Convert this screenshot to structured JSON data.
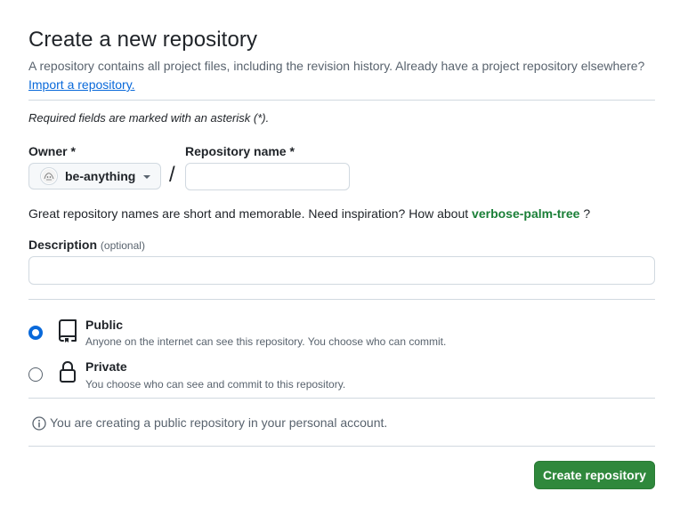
{
  "header": {
    "title": "Create a new repository",
    "subtitle": "A repository contains all project files, including the revision history. Already have a project repository elsewhere?",
    "import_link": "Import a repository."
  },
  "form": {
    "required_note": "Required fields are marked with an asterisk (*).",
    "owner": {
      "label": "Owner *",
      "selected": "be-anything"
    },
    "separator": "/",
    "repo_name": {
      "label": "Repository name *",
      "value": ""
    },
    "name_hint": {
      "prefix": "Great repository names are short and memorable. Need inspiration? How about",
      "suggestion": "verbose-palm-tree",
      "suffix": "?"
    },
    "description": {
      "label": "Description",
      "optional": "(optional)",
      "value": ""
    },
    "visibility": [
      {
        "title": "Public",
        "description": "Anyone on the internet can see this repository. You choose who can commit.",
        "checked": true,
        "icon": "repo-icon"
      },
      {
        "title": "Private",
        "description": "You choose who can see and commit to this repository.",
        "checked": false,
        "icon": "lock-icon"
      }
    ],
    "info": "You are creating a public repository in your personal account.",
    "submit_label": "Create repository"
  },
  "colors": {
    "accent": "#0969da",
    "primary_button": "#2f883c",
    "suggestion": "#1a7f37"
  }
}
